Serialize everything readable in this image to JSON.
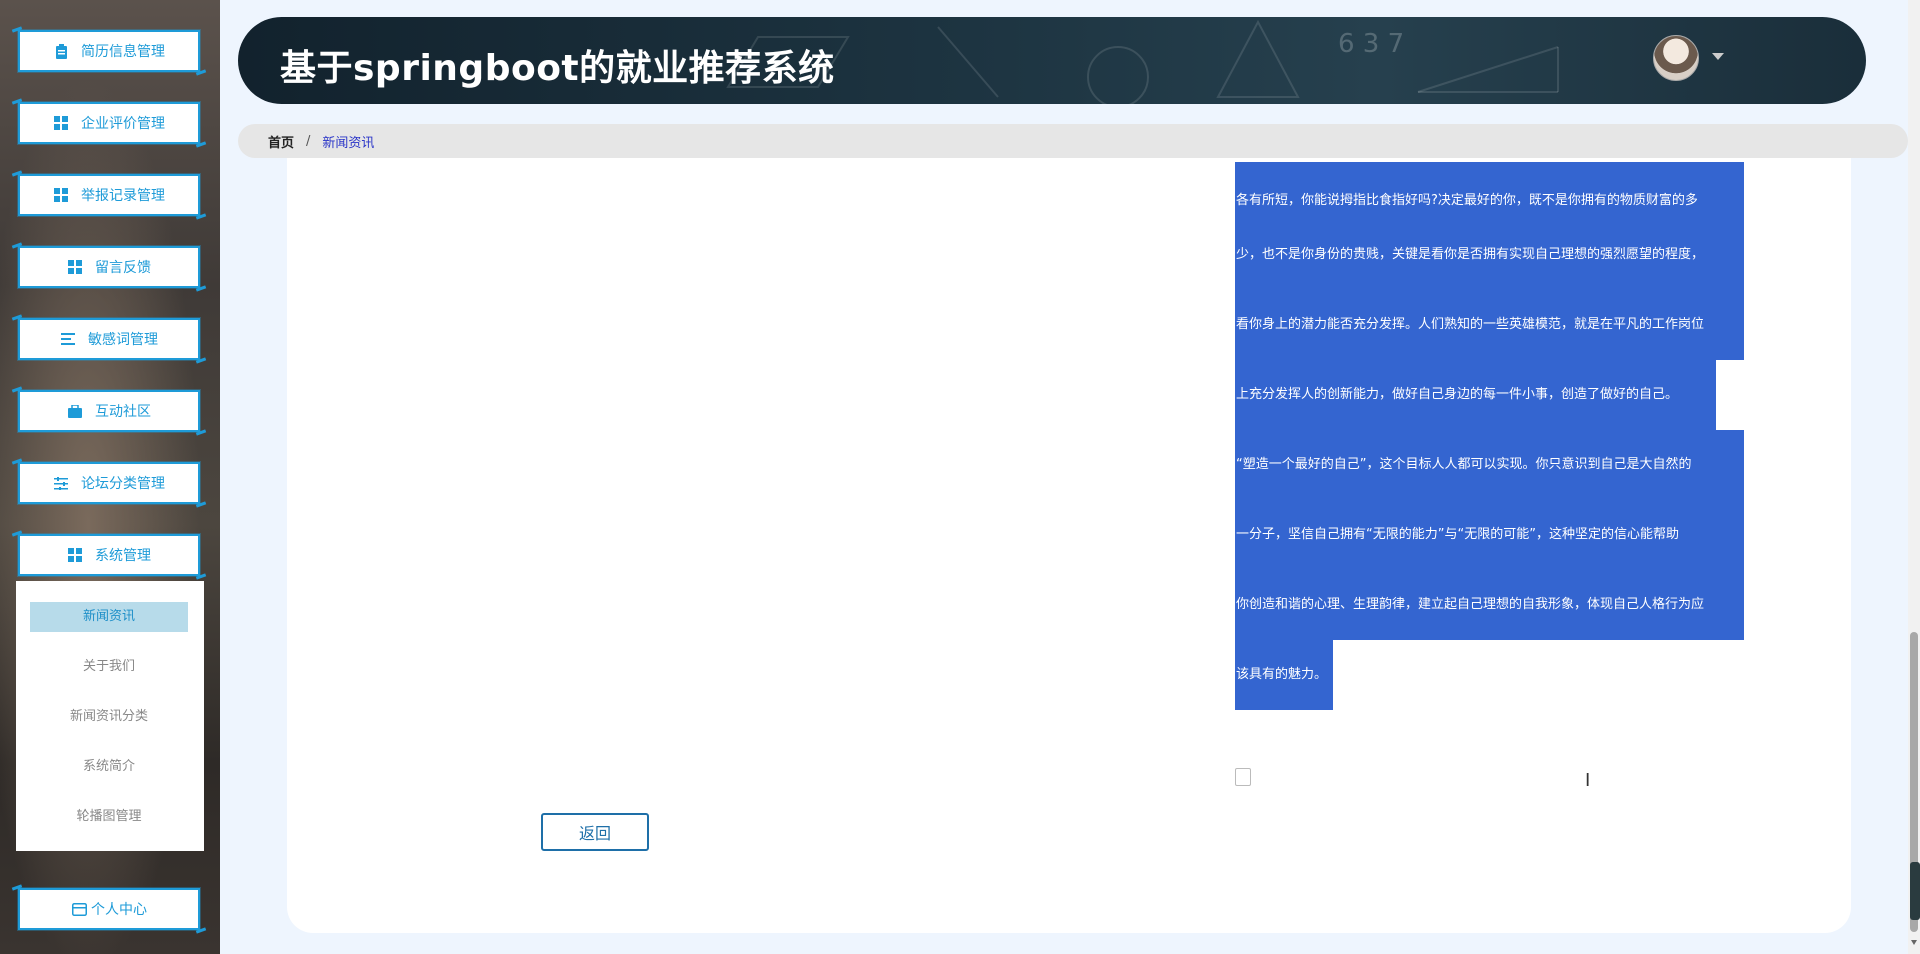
{
  "app": {
    "title": "基于springboot的就业推荐系统"
  },
  "sidebar": {
    "items": [
      {
        "label": "简历信息管理",
        "icon": "clipboard-icon"
      },
      {
        "label": "企业评价管理",
        "icon": "grid-icon"
      },
      {
        "label": "举报记录管理",
        "icon": "grid-icon"
      },
      {
        "label": "留言反馈",
        "icon": "grid-icon"
      },
      {
        "label": "敏感词管理",
        "icon": "list-icon"
      },
      {
        "label": "互动社区",
        "icon": "briefcase-icon"
      },
      {
        "label": "论坛分类管理",
        "icon": "sliders-icon"
      },
      {
        "label": "系统管理",
        "icon": "grid-icon"
      }
    ],
    "submenu": [
      {
        "label": "新闻资讯",
        "active": true
      },
      {
        "label": "关于我们",
        "active": false
      },
      {
        "label": "新闻资讯分类",
        "active": false
      },
      {
        "label": "系统简介",
        "active": false
      },
      {
        "label": "轮播图管理",
        "active": false
      }
    ],
    "personal": {
      "label": "个人中心",
      "icon": "card-icon"
    }
  },
  "breadcrumb": {
    "home": "首页",
    "separator": "/",
    "current": "新闻资讯"
  },
  "article": {
    "lines": [
      "各有所短，你能说拇指比食指好吗?决定最好的你，既不是你拥有的物质财富的多",
      "少，也不是你身份的贵贱，关键是看你是否拥有实现自己理想的强烈愿望的程度，",
      "看你身上的潜力能否充分发挥。人们熟知的一些英雄模范，就是在平凡的工作岗位",
      "上充分发挥人的创新能力，做好自己身边的每一件小事，创造了做好的自己。",
      "“塑造一个最好的自己”，这个目标人人都可以实现。你只意识到自己是大自然的",
      "一分子，坚信自己拥有“无限的能力”与“无限的可能”，这种坚定的信心能帮助",
      "你创造和谐的心理、生理韵律，建立起自己理想的自我形象，体现自己人格行为应",
      "该具有的魅力。"
    ]
  },
  "buttons": {
    "back": "返回"
  },
  "colors": {
    "accent": "#1e9bd8",
    "selection": "#3465d0",
    "header": "#1d3441"
  }
}
